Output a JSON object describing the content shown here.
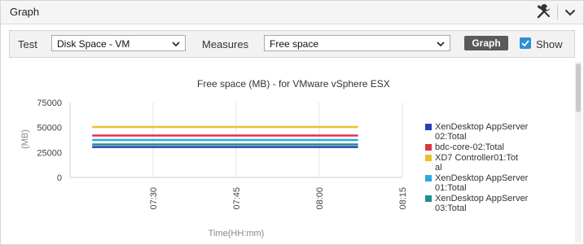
{
  "header": {
    "title": "Graph"
  },
  "toolbar": {
    "test_label": "Test",
    "test_value": "Disk Space - VM",
    "measures_label": "Measures",
    "measures_value": "Free space",
    "graph_button": "Graph",
    "show_label": "Show",
    "show_checked": true
  },
  "colors": {
    "accent": "#2d8fd5",
    "button": "#5a5a5a"
  },
  "chart_data": {
    "type": "line",
    "title": "Free space (MB) - for VMware vSphere ESX",
    "xlabel": "Time(HH:mm)",
    "ylabel": "(MB)",
    "y_ticks": [
      "75000",
      "50000",
      "25000",
      "0"
    ],
    "x_ticks": [
      "07:30",
      "07:45",
      "08:00",
      "08:15"
    ],
    "ylim": [
      0,
      75000
    ],
    "xlim": [
      "07:15",
      "08:15"
    ],
    "x": [
      "07:19",
      "08:07"
    ],
    "grid": "vertical",
    "legend_position": "right",
    "series": [
      {
        "name": "XenDesktop AppServer 02:Total",
        "color": "#2c3fb0",
        "values": [
          30500,
          30500
        ]
      },
      {
        "name": "bdc-core-02:Total",
        "color": "#e0314a",
        "values": [
          42000,
          42000
        ]
      },
      {
        "name": "XD7 Controller01:Total",
        "color": "#e8c22c",
        "values": [
          50500,
          50500
        ]
      },
      {
        "name": "XenDesktop AppServer 01:Total",
        "color": "#2fa6df",
        "values": [
          37500,
          37500
        ]
      },
      {
        "name": "XenDesktop AppServer 03:Total",
        "color": "#1e8f8f",
        "values": [
          33000,
          33000
        ]
      }
    ],
    "legend_lines": [
      [
        "XenDesktop AppServer",
        "02:Total"
      ],
      [
        "bdc-core-02:Total"
      ],
      [
        "XD7 Controller01:Tot",
        "al"
      ],
      [
        "XenDesktop AppServer",
        "01:Total"
      ],
      [
        "XenDesktop AppServer",
        "03:Total"
      ]
    ]
  }
}
